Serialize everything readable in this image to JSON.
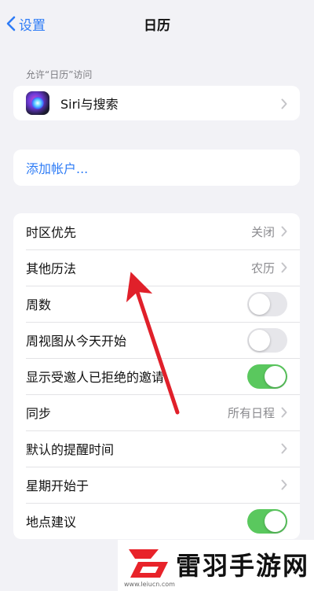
{
  "nav": {
    "back_label": "设置",
    "title": "日历"
  },
  "access_section": {
    "header": "允许“日历”访问",
    "siri_label": "Siri与搜索"
  },
  "accounts": {
    "add_account": "添加帐户..."
  },
  "settings": {
    "timezone": {
      "label": "时区优先",
      "value": "关闭"
    },
    "alt_calendar": {
      "label": "其他历法",
      "value": "农历"
    },
    "week_numbers": {
      "label": "周数",
      "enabled": false
    },
    "week_view_today": {
      "label": "周视图从今天开始",
      "enabled": false
    },
    "declined": {
      "label": "显示受邀人已拒绝的邀请",
      "enabled": true
    },
    "sync": {
      "label": "同步",
      "value": "所有日程"
    },
    "default_alert": {
      "label": "默认的提醒时间"
    },
    "week_start": {
      "label": "星期开始于"
    },
    "location": {
      "label": "地点建议",
      "enabled": true
    }
  },
  "colors": {
    "accent": "#2e7cf6",
    "toggle_on": "#5ac85e",
    "arrow": "#e0202a",
    "background": "#f2f2f6"
  },
  "watermark": {
    "brand": "雷羽手游网",
    "url": "www.leiucn.com"
  }
}
